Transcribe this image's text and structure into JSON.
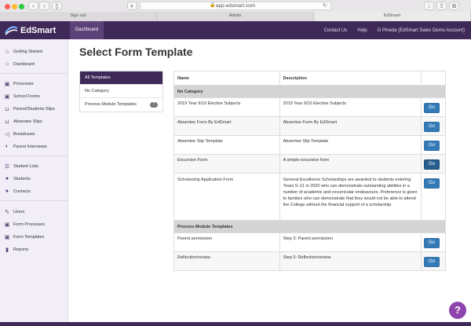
{
  "browser": {
    "url": "app.edsmart.com",
    "tabs": [
      "Sign out",
      "Admin",
      "EdSmart"
    ]
  },
  "topnav": {
    "brand": "EdSmart",
    "dashboard_tab": "Dashboard",
    "contact": "Contact Us",
    "help": "Help",
    "user": "G Pineda (EdSmart Sales Demo Account)"
  },
  "sidebar": {
    "items": [
      {
        "label": "Getting Started",
        "icon": "star-icon"
      },
      {
        "label": "Dashboard",
        "icon": "home-icon"
      },
      {
        "label": "Processes",
        "icon": "briefcase-icon"
      },
      {
        "label": "School Forms",
        "icon": "briefcase-icon"
      },
      {
        "label": "Parent/Students Slips",
        "icon": "inbox-icon"
      },
      {
        "label": "Absentee Slips",
        "icon": "inbox-icon"
      },
      {
        "label": "Broadcasts",
        "icon": "broadcast-icon"
      },
      {
        "label": "Parent Interviews",
        "icon": "half-circle-icon"
      },
      {
        "label": "Student Lists",
        "icon": "list-icon"
      },
      {
        "label": "Students",
        "icon": "user-icon"
      },
      {
        "label": "Contacts",
        "icon": "user-icon"
      },
      {
        "label": "Users",
        "icon": "wrench-icon"
      },
      {
        "label": "Form Processes",
        "icon": "briefcase-icon"
      },
      {
        "label": "Form Templates",
        "icon": "briefcase-icon"
      },
      {
        "label": "Reports",
        "icon": "bar-chart-icon"
      }
    ]
  },
  "main": {
    "title": "Select Form Template",
    "filters": [
      {
        "label": "All Templates",
        "badge": ""
      },
      {
        "label": "No Category",
        "badge": ""
      },
      {
        "label": "Process Module Templates",
        "badge": "7"
      }
    ],
    "table": {
      "headers": [
        "Name",
        "Description",
        ""
      ],
      "go_label": "Go",
      "groups": [
        {
          "title": "No Category",
          "rows": [
            {
              "name": "2019 Year 9/10 Elective Subjects",
              "description": "2019 Year 9/10 Elective Subjects"
            },
            {
              "name": "Absentee Form By EdSmart",
              "description": "Absentee Form By EdSmart"
            },
            {
              "name": "Absentee Slip Template",
              "description": "Absentee Slip Template"
            },
            {
              "name": "Excursion Form",
              "description": "A simple excursion form"
            },
            {
              "name": "Scholarship Application Form",
              "description": "General Excellence Scholarships are awarded to students entering Years 5–11 in 2020 who can demonstrate outstanding abilities in a number of academic and cocurricular endeavours. Preference is given to families who can demonstrate that they would not be able to attend the College without the financial support of a scholarship."
            }
          ]
        },
        {
          "title": "Process Module Templates",
          "rows": [
            {
              "name": "Parent permission",
              "description": "Step 3: Parent permission"
            },
            {
              "name": "Reflection/review",
              "description": "Step 5: Reflection/review"
            }
          ]
        }
      ]
    },
    "help_label": "?"
  },
  "colors": {
    "brand": "#3f2958",
    "go_button": "#337ab7",
    "help_button": "#8e44ad"
  }
}
